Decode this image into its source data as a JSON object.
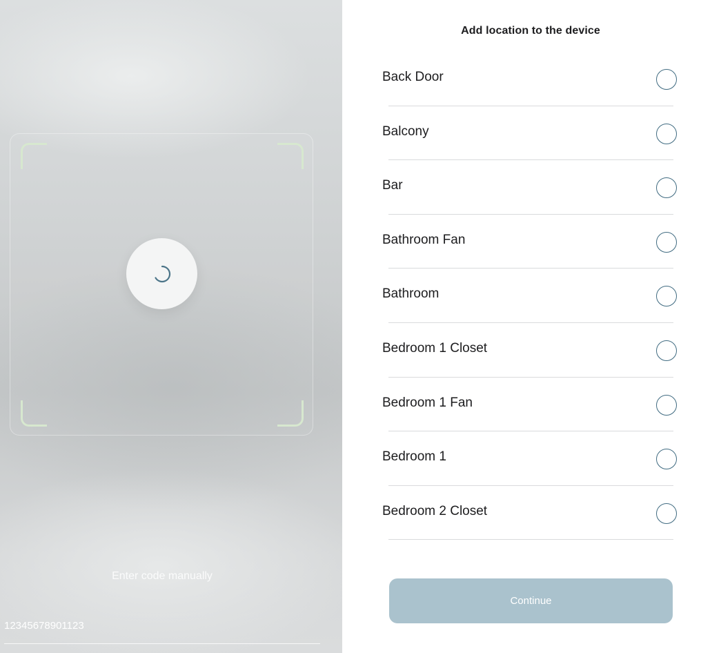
{
  "scanner": {
    "manual_entry_label": "Enter code manually",
    "code_value": "12345678901123"
  },
  "locations": {
    "title": "Add location to the device",
    "items": [
      {
        "label": "Back Door",
        "selected": false
      },
      {
        "label": "Balcony",
        "selected": false
      },
      {
        "label": "Bar",
        "selected": false
      },
      {
        "label": "Bathroom Fan",
        "selected": false
      },
      {
        "label": "Bathroom",
        "selected": false
      },
      {
        "label": "Bedroom 1 Closet",
        "selected": false
      },
      {
        "label": "Bedroom 1 Fan",
        "selected": false
      },
      {
        "label": "Bedroom 1",
        "selected": false
      },
      {
        "label": "Bedroom 2 Closet",
        "selected": false
      }
    ],
    "continue_label": "Continue"
  },
  "colors": {
    "radio_border": "#3f6a80",
    "continue_button": "#aac2cd",
    "scan_corners": "#d7e8cf"
  },
  "icons": {
    "spinner": "loading-spinner-icon",
    "radio": "radio-unchecked-icon"
  }
}
